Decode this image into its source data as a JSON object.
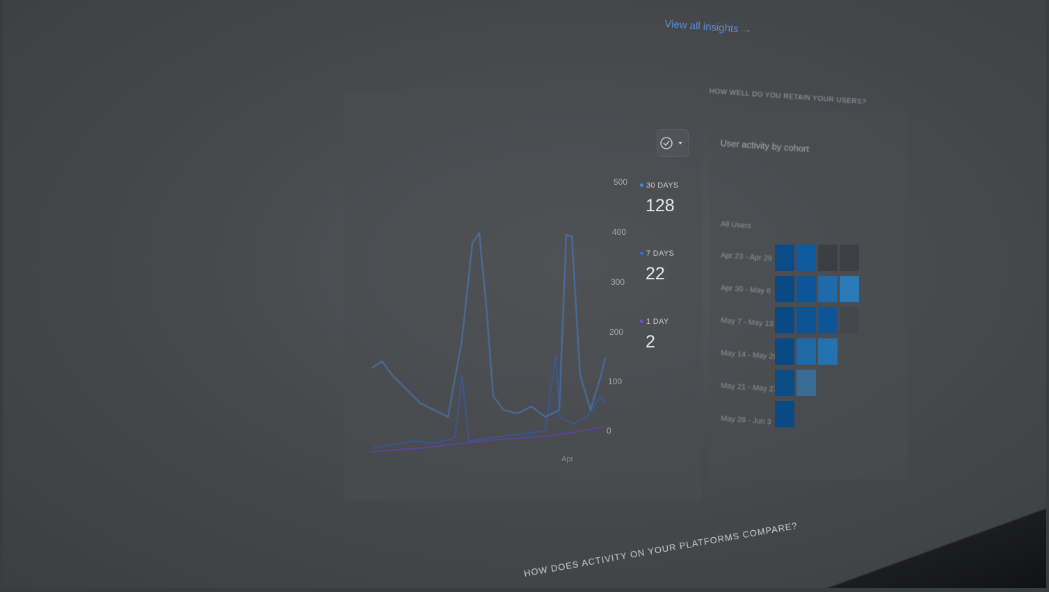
{
  "photo": {
    "overlay_color": "#3a3c40",
    "accent_color": "#1f6fd6"
  },
  "header": {
    "insights_link": "View all insights →"
  },
  "chart": {
    "y_ticks": [
      "500",
      "400",
      "300",
      "200",
      "100",
      "0"
    ],
    "legend": [
      {
        "label": "30 DAYS",
        "value": "128",
        "color": "#3b8fe0"
      },
      {
        "label": "7 DAYS",
        "value": "22",
        "color": "#2f6fd8"
      },
      {
        "label": "1 DAY",
        "value": "2",
        "color": "#6a4fd0"
      }
    ],
    "x_tick": "Apr"
  },
  "retention": {
    "section_title": "HOW WELL DO YOU RETAIN YOUR USERS?",
    "card_title": "User activity by cohort",
    "row_labels": [
      "All Users",
      "Apr 23 - Apr 29",
      "Apr 30 - May 6",
      "May 7 - May 13",
      "May 14 - May 20",
      "May 21 - May 27",
      "May 28 - Jun 3"
    ]
  },
  "platforms": {
    "section_title": "HOW DOES ACTIVITY ON YOUR PLATFORMS COMPARE?"
  }
}
